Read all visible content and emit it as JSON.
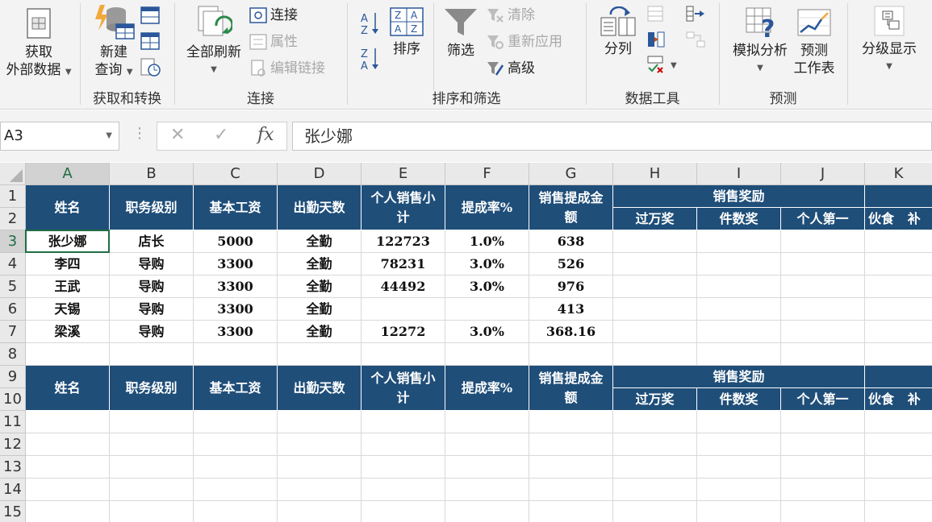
{
  "ribbon": {
    "groups": {
      "get_transform": "获取和转换",
      "connections": "连接",
      "sort_filter": "排序和筛选",
      "data_tools": "数据工具",
      "forecast": "预测"
    },
    "buttons": {
      "get_external_1": "获取",
      "get_external_2": "外部数据",
      "new_query_1": "新建",
      "new_query_2": "查询",
      "refresh_all": "全部刷新",
      "connections": "连接",
      "properties": "属性",
      "edit_links": "编辑链接",
      "sort": "排序",
      "filter": "筛选",
      "clear": "清除",
      "reapply": "重新应用",
      "advanced": "高级",
      "text_to_columns": "分列",
      "what_if": "模拟分析",
      "forecast_sheet_1": "预测",
      "forecast_sheet_2": "工作表",
      "outline": "分级显示"
    }
  },
  "formula_bar": {
    "name_box": "A3",
    "formula": "张少娜"
  },
  "columns": [
    "A",
    "B",
    "C",
    "D",
    "E",
    "F",
    "G",
    "H",
    "I",
    "J",
    "K"
  ],
  "rows": [
    "1",
    "2",
    "3",
    "4",
    "5",
    "6",
    "7",
    "8",
    "9",
    "10",
    "11",
    "12",
    "13",
    "14",
    "15"
  ],
  "header": {
    "name": "姓名",
    "level": "职务级别",
    "base_salary": "基本工资",
    "attendance": "出勤天数",
    "sales_1": "个人销售小",
    "sales_2": "计",
    "rate": "提成率%",
    "commission_1": "销售提成金",
    "commission_2": "额",
    "bonus": "销售奖励",
    "over_10k": "过万奖",
    "count_bonus": "件数奖",
    "top_individual": "个人第一",
    "meals": "伙食   补"
  },
  "records": [
    [
      "张少娜",
      "店长",
      "5000",
      "全勤",
      "122723",
      "1.0%",
      "638"
    ],
    [
      "李四",
      "导购",
      "3300",
      "全勤",
      "78231",
      "3.0%",
      "526"
    ],
    [
      "王武",
      "导购",
      "3300",
      "全勤",
      "44492",
      "3.0%",
      "976"
    ],
    [
      "天锡",
      "导购",
      "3300",
      "全勤",
      "",
      "",
      "413"
    ],
    [
      "梁溪",
      "导购",
      "3300",
      "全勤",
      "12272",
      "3.0%",
      "368.16"
    ]
  ]
}
